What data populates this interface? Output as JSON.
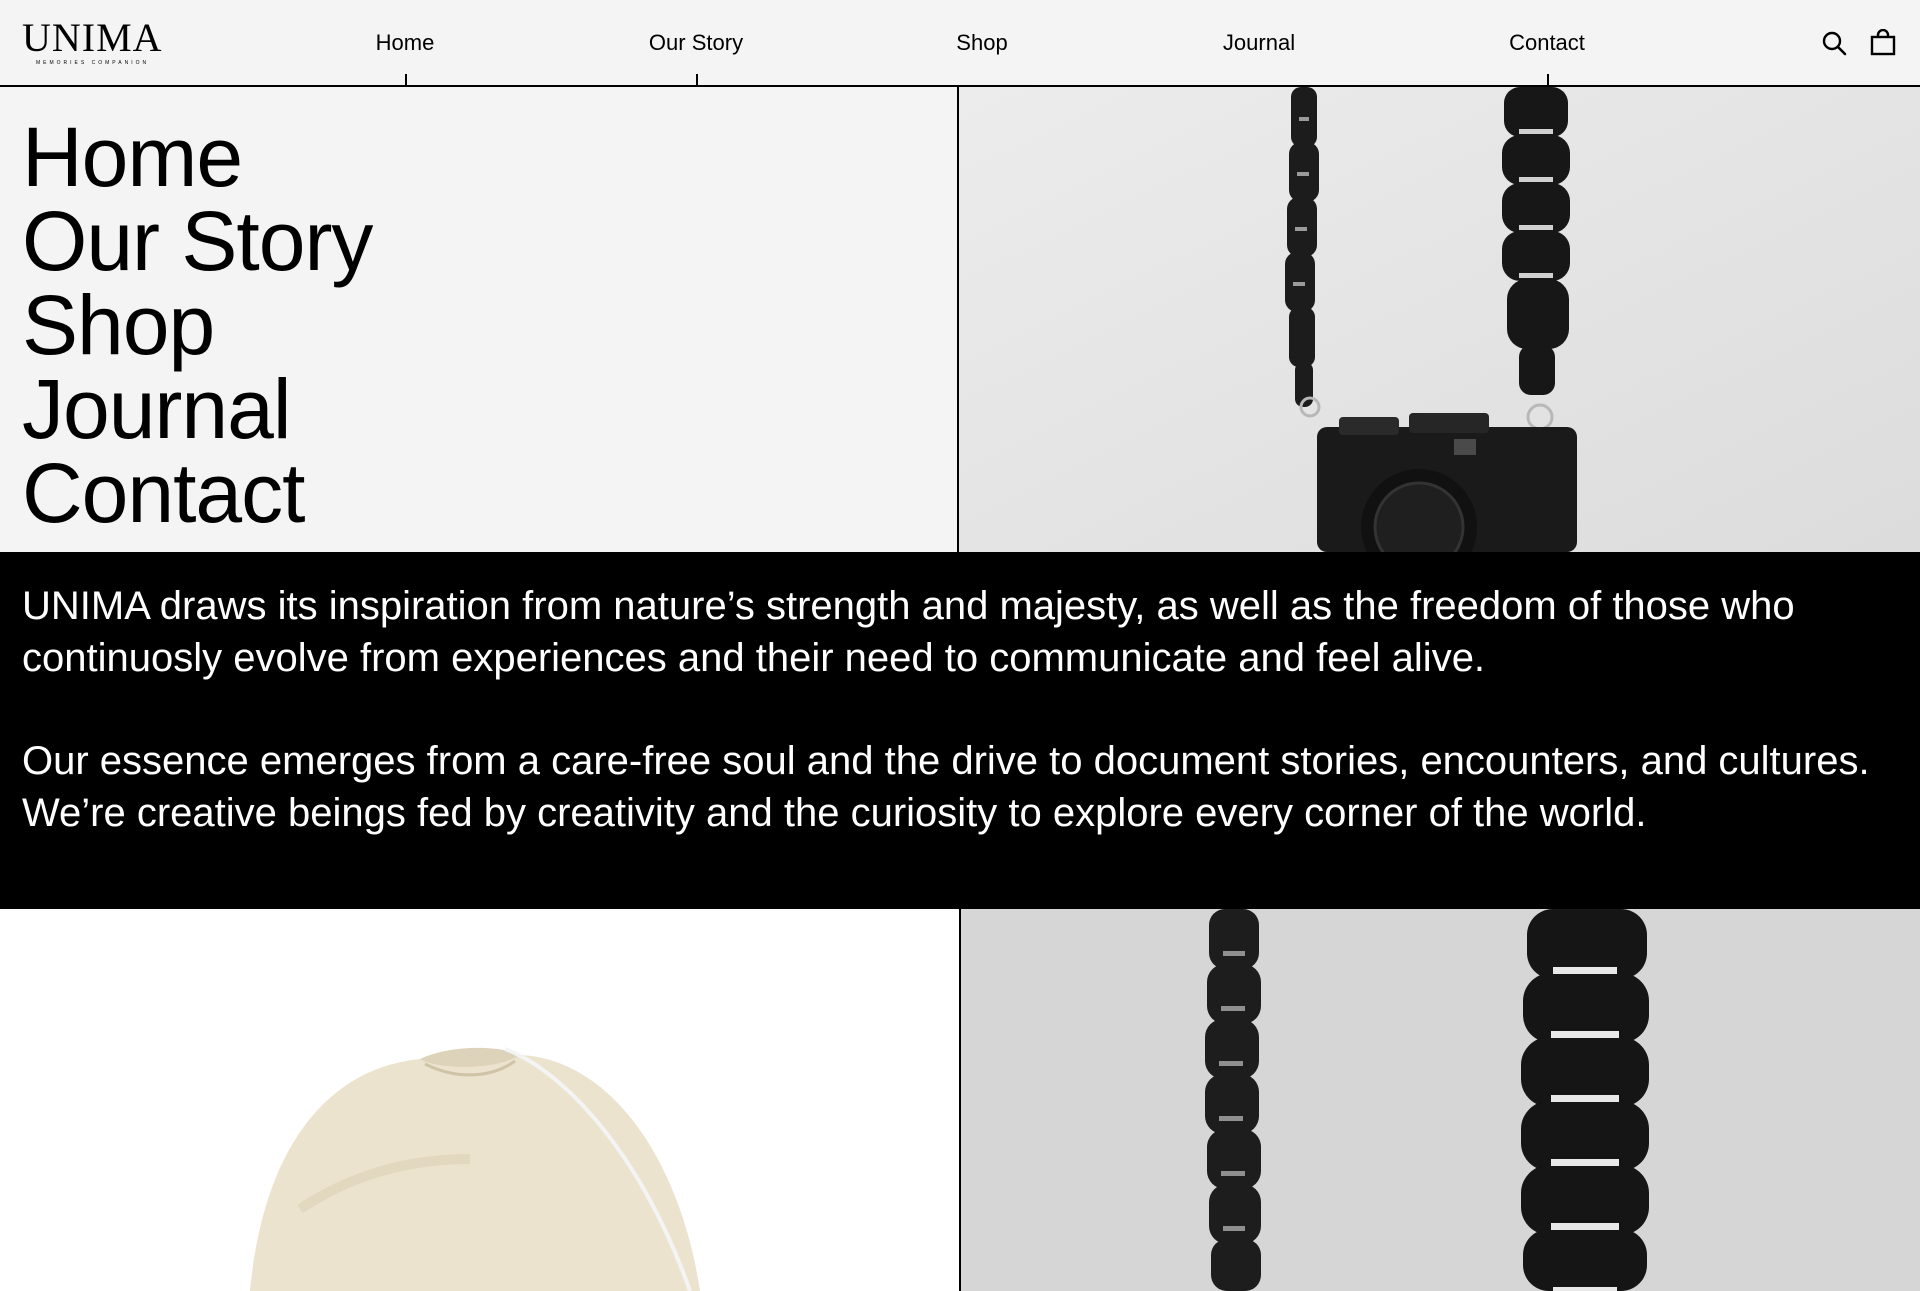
{
  "brand": {
    "name": "UNIMA",
    "tagline": "MEMORIES COMPANION"
  },
  "header": {
    "nav": [
      {
        "label": "Home"
      },
      {
        "label": "Our Story"
      },
      {
        "label": "Shop"
      },
      {
        "label": "Journal"
      },
      {
        "label": "Contact"
      }
    ],
    "icons": [
      "search-icon",
      "bag-icon"
    ]
  },
  "menu": {
    "items": [
      "Home",
      "Our Story",
      "Shop",
      "Journal",
      "Contact"
    ]
  },
  "about": {
    "paragraph_1": "UNIMA draws its inspiration from nature’s strength and majesty, as well as the freedom of those who continuosly evolve from experiences and their need to communicate and feel alive.",
    "paragraph_2": "Our essence emerges from a care-free soul and the drive to document stories, encounters, and cultures. We’re creative beings fed by creativity and the curiosity to explore every corner of the world."
  },
  "colors": {
    "background": "#f4f4f4",
    "band": "#000000",
    "text": "#000000",
    "band_text": "#ffffff"
  }
}
